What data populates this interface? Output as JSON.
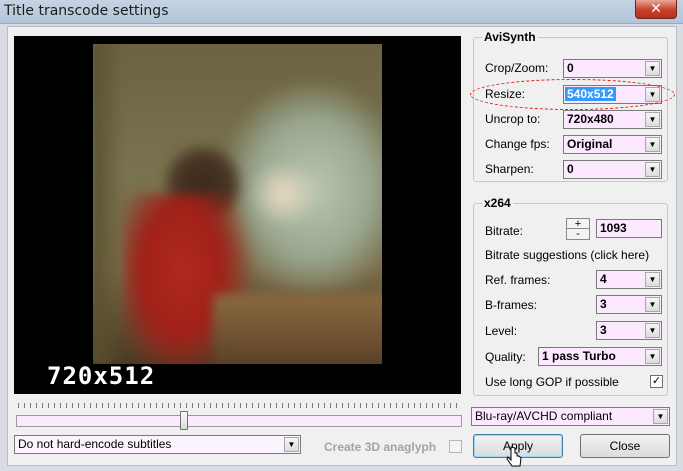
{
  "window": {
    "title": "Title transcode settings",
    "close_glyph": "✕"
  },
  "preview": {
    "osd_text": "720x512"
  },
  "avisynth": {
    "legend": "AviSynth",
    "rows": [
      {
        "label": "Crop/Zoom:",
        "value": "0"
      },
      {
        "label": "Resize:",
        "value": "540x512"
      },
      {
        "label": "Uncrop to:",
        "value": "720x480"
      },
      {
        "label": "Change fps:",
        "value": "Original"
      },
      {
        "label": "Sharpen:",
        "value": "0"
      }
    ]
  },
  "x264": {
    "legend": "x264",
    "bitrate_label": "Bitrate:",
    "bitrate_plus": "+",
    "bitrate_minus": "-",
    "bitrate_value": "1093",
    "suggestions_link": "Bitrate suggestions (click here)",
    "ref_frames_label": "Ref. frames:",
    "ref_frames_value": "4",
    "bframes_label": "B-frames:",
    "bframes_value": "3",
    "level_label": "Level:",
    "level_value": "3",
    "quality_label": "Quality:",
    "quality_value": "1 pass Turbo",
    "long_gop_label": "Use long GOP if possible",
    "long_gop_check": "✓"
  },
  "bottom": {
    "compat_value": "Blu-ray/AVCHD compliant",
    "subtitles_value": "Do not hard-encode subtitles",
    "anaglyph_label": "Create 3D anaglyph",
    "apply_label": "Apply",
    "close_label": "Close",
    "dropdown_arrow": "▼"
  }
}
